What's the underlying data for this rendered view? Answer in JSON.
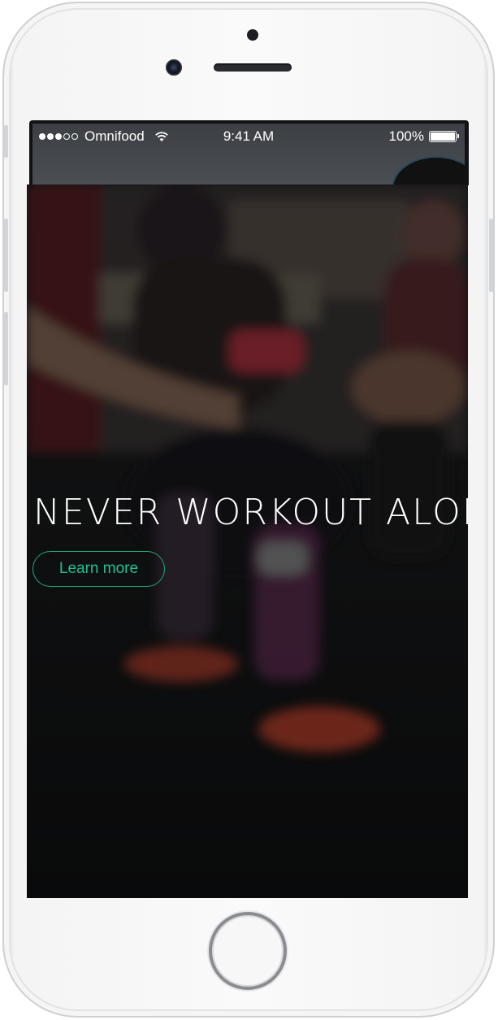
{
  "status_bar": {
    "carrier": "Omnifood",
    "time": "9:41 AM",
    "battery_percent": "100%",
    "signal_bars_filled": 3,
    "signal_bars_total": 5
  },
  "hero": {
    "title": "NEVER WORKOUT ALONE",
    "cta_label": "Learn more"
  },
  "colors": {
    "accent": "#1fa97a",
    "cta_text": "#20c08a",
    "hero_text": "#ffffff"
  },
  "icons": [
    "wifi-icon",
    "battery-icon",
    "signal-icon",
    "camera-icon",
    "home-button"
  ]
}
